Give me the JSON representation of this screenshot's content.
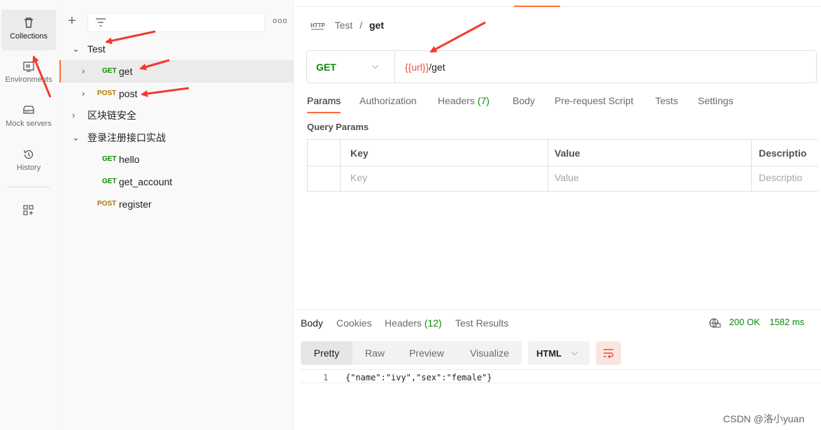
{
  "rail": {
    "items": [
      {
        "label": "Collections",
        "icon": "trash-can-icon"
      },
      {
        "label": "Environments",
        "icon": "environment-icon"
      },
      {
        "label": "Mock servers",
        "icon": "server-icon"
      },
      {
        "label": "History",
        "icon": "history-icon"
      }
    ],
    "add_workspace_icon": "apps-add-icon"
  },
  "sidebar": {
    "more_label": "ooo",
    "tree": [
      {
        "type": "folder",
        "chevron": "⌄",
        "label": "Test"
      },
      {
        "type": "request",
        "chevron": "›",
        "method": "GET",
        "label": "get"
      },
      {
        "type": "request",
        "chevron": "›",
        "method": "POST",
        "label": "post"
      },
      {
        "type": "folder",
        "chevron": "›",
        "label": "区块链安全"
      },
      {
        "type": "folder",
        "chevron": "⌄",
        "label": "登录注册接口实战"
      },
      {
        "type": "request",
        "method": "GET",
        "label": "hello"
      },
      {
        "type": "request",
        "method": "GET",
        "label": "get_account"
      },
      {
        "type": "request",
        "method": "POST",
        "label": "register"
      }
    ]
  },
  "breadcrumb": {
    "collection": "Test",
    "separator": "/",
    "request": "get"
  },
  "request": {
    "method": "GET",
    "url_var": "{{url}}",
    "url_path": "/get"
  },
  "req_tabs": [
    {
      "label": "Params"
    },
    {
      "label": "Authorization"
    },
    {
      "label": "Headers",
      "count": "(7)"
    },
    {
      "label": "Body"
    },
    {
      "label": "Pre-request Script"
    },
    {
      "label": "Tests"
    },
    {
      "label": "Settings"
    }
  ],
  "query_params": {
    "title": "Query Params",
    "headers": [
      "Key",
      "Value",
      "Descriptio"
    ],
    "placeholders": [
      "Key",
      "Value",
      "Descriptio"
    ]
  },
  "response": {
    "tabs": [
      {
        "label": "Body"
      },
      {
        "label": "Cookies"
      },
      {
        "label": "Headers",
        "count": "(12)"
      },
      {
        "label": "Test Results"
      }
    ],
    "status": "200 OK",
    "time": "1582 ms",
    "formats": [
      "Pretty",
      "Raw",
      "Preview",
      "Visualize"
    ],
    "language": "HTML",
    "lines": [
      {
        "no": "1",
        "text": "{\"name\":\"ivy\",\"sex\":\"female\"}"
      }
    ]
  },
  "watermark": "CSDN @洛小yuan",
  "colors": {
    "accent": "#ff6c37",
    "get": "#0b8a00",
    "post": "#ad7a03",
    "arrow": "#f23a2e",
    "var": "#e05243"
  }
}
